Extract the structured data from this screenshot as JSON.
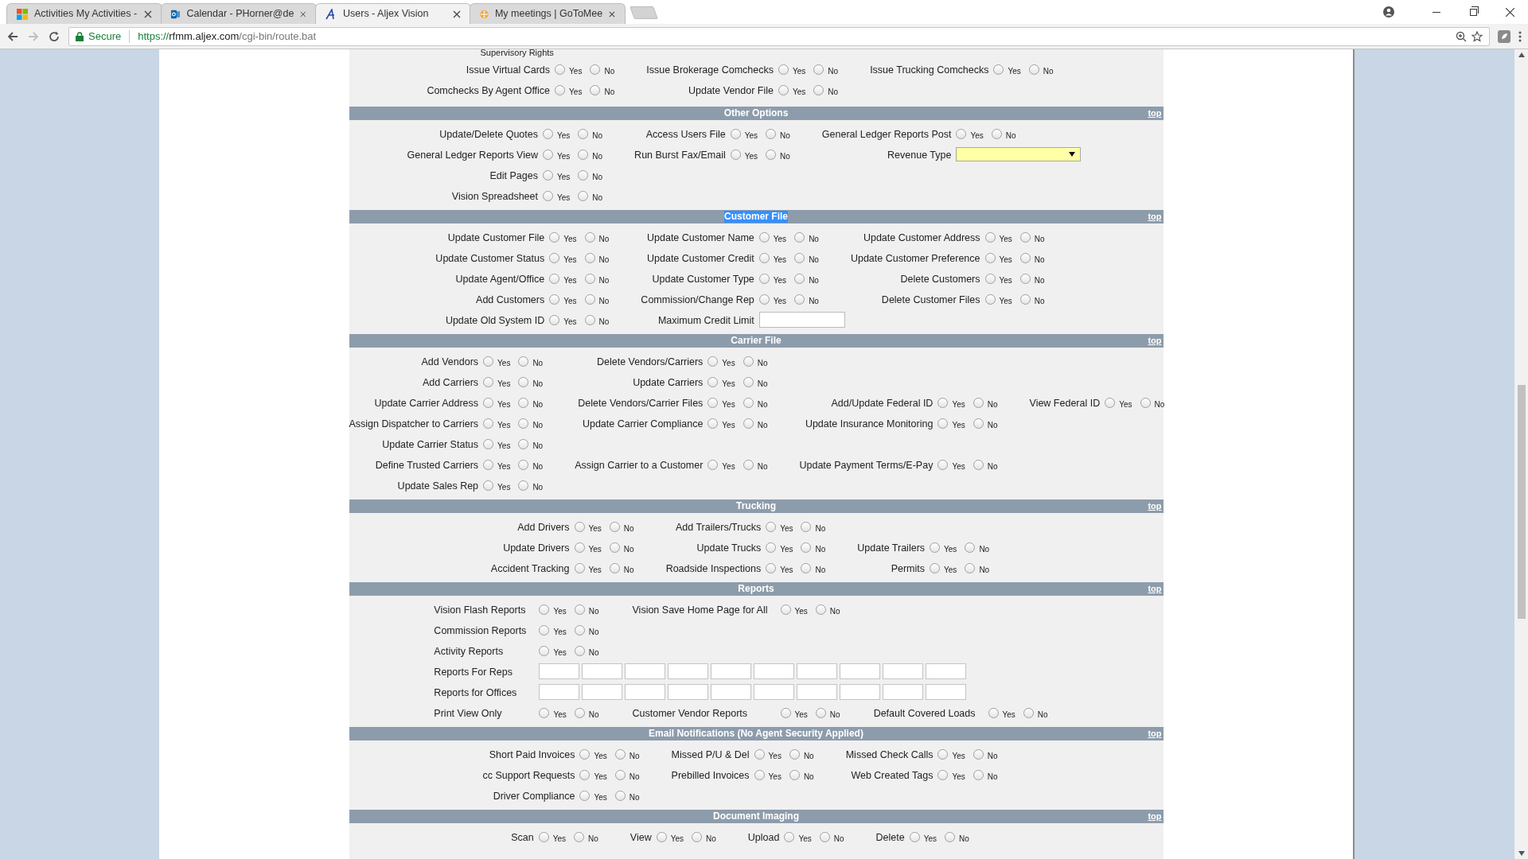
{
  "browser": {
    "tabs": [
      {
        "title": "Activities My Activities -",
        "selected": false
      },
      {
        "title": "Calendar - PHorner@de",
        "selected": false
      },
      {
        "title": "Users - Aljex Vision",
        "selected": true
      },
      {
        "title": "My meetings | GoToMee",
        "selected": false
      }
    ],
    "security": "Secure",
    "url_scheme": "https://",
    "url_host": "rfmm.aljex.com",
    "url_path": "/cgi-bin/route.bat"
  },
  "top_section": {
    "caption": "Supervisory Rights",
    "rows": [
      [
        {
          "kind": "yesno",
          "label": "Issue Virtual Cards",
          "options": [
            {
              "label": "Yes",
              "selected": false
            },
            {
              "label": "No",
              "selected": false
            }
          ]
        },
        {
          "kind": "yesno",
          "label": "Issue Brokerage Comchecks",
          "options": [
            {
              "label": "Yes",
              "selected": false
            },
            {
              "label": "No",
              "selected": false
            }
          ]
        },
        {
          "kind": "yesno",
          "label": "Issue Trucking Comchecks",
          "options": [
            {
              "label": "Yes",
              "selected": false
            },
            {
              "label": "No",
              "selected": false
            }
          ]
        }
      ],
      [
        {
          "kind": "yesno",
          "label": "Comchecks By Agent Office",
          "options": [
            {
              "label": "Yes",
              "selected": false
            },
            {
              "label": "No",
              "selected": false
            }
          ]
        },
        {
          "kind": "yesno",
          "label": "Update Vendor File",
          "options": [
            {
              "label": "Yes",
              "selected": false
            },
            {
              "label": "No",
              "selected": false
            }
          ]
        }
      ]
    ]
  },
  "sections": [
    {
      "title": "Other Options",
      "title_selected": false,
      "top_link": "top",
      "kind": "standard",
      "rows": [
        [
          {
            "kind": "yesno",
            "label": "Update/Delete Quotes",
            "options": [
              {
                "label": "Yes",
                "selected": false
              },
              {
                "label": "No",
                "selected": false
              }
            ]
          },
          {
            "kind": "yesno",
            "label": "Access Users File",
            "options": [
              {
                "label": "Yes",
                "selected": false
              },
              {
                "label": "No",
                "selected": false
              }
            ]
          },
          {
            "kind": "yesno",
            "label": "General Ledger Reports Post",
            "options": [
              {
                "label": "Yes",
                "selected": false
              },
              {
                "label": "No",
                "selected": false
              }
            ]
          }
        ],
        [
          {
            "kind": "yesno",
            "label": "General Ledger Reports View",
            "options": [
              {
                "label": "Yes",
                "selected": false
              },
              {
                "label": "No",
                "selected": false
              }
            ]
          },
          {
            "kind": "yesno",
            "label": "Run Burst Fax/Email",
            "options": [
              {
                "label": "Yes",
                "selected": false
              },
              {
                "label": "No",
                "selected": false
              }
            ]
          },
          {
            "kind": "select",
            "label": "Revenue Type"
          }
        ],
        [
          {
            "kind": "yesno",
            "label": "Edit Pages",
            "options": [
              {
                "label": "Yes",
                "selected": false
              },
              {
                "label": "No",
                "selected": false
              }
            ]
          }
        ],
        [
          {
            "kind": "yesno",
            "label": "Vision Spreadsheet",
            "options": [
              {
                "label": "Yes",
                "selected": false
              },
              {
                "label": "No",
                "selected": false
              }
            ]
          }
        ]
      ]
    },
    {
      "title": "Customer File",
      "title_selected": true,
      "top_link": "top",
      "kind": "standard",
      "rows": [
        [
          {
            "kind": "yesno",
            "label": "Update Customer File",
            "options": [
              {
                "label": "Yes",
                "selected": false
              },
              {
                "label": "No",
                "selected": false
              }
            ]
          },
          {
            "kind": "yesno",
            "label": "Update Customer Name",
            "options": [
              {
                "label": "Yes",
                "selected": false
              },
              {
                "label": "No",
                "selected": false
              }
            ]
          },
          {
            "kind": "yesno",
            "label": "Update Customer Address",
            "options": [
              {
                "label": "Yes",
                "selected": false
              },
              {
                "label": "No",
                "selected": false
              }
            ]
          }
        ],
        [
          {
            "kind": "yesno",
            "label": "Update Customer Status",
            "options": [
              {
                "label": "Yes",
                "selected": false
              },
              {
                "label": "No",
                "selected": false
              }
            ]
          },
          {
            "kind": "yesno",
            "label": "Update Customer Credit",
            "options": [
              {
                "label": "Yes",
                "selected": false
              },
              {
                "label": "No",
                "selected": false
              }
            ]
          },
          {
            "kind": "yesno",
            "label": "Update Customer Preference",
            "options": [
              {
                "label": "Yes",
                "selected": false
              },
              {
                "label": "No",
                "selected": false
              }
            ]
          }
        ],
        [
          {
            "kind": "yesno",
            "label": "Update Agent/Office",
            "options": [
              {
                "label": "Yes",
                "selected": false
              },
              {
                "label": "No",
                "selected": false
              }
            ]
          },
          {
            "kind": "yesno",
            "label": "Update Customer Type",
            "options": [
              {
                "label": "Yes",
                "selected": false
              },
              {
                "label": "No",
                "selected": false
              }
            ]
          },
          {
            "kind": "yesno",
            "label": "Delete Customers",
            "options": [
              {
                "label": "Yes",
                "selected": false
              },
              {
                "label": "No",
                "selected": false
              }
            ]
          }
        ],
        [
          {
            "kind": "yesno",
            "label": "Add Customers",
            "options": [
              {
                "label": "Yes",
                "selected": false
              },
              {
                "label": "No",
                "selected": false
              }
            ]
          },
          {
            "kind": "yesno",
            "label": "Commission/Change Rep",
            "options": [
              {
                "label": "Yes",
                "selected": false
              },
              {
                "label": "No",
                "selected": false
              }
            ]
          },
          {
            "kind": "yesno",
            "label": "Delete Customer Files",
            "options": [
              {
                "label": "Yes",
                "selected": false
              },
              {
                "label": "No",
                "selected": false
              }
            ]
          }
        ],
        [
          {
            "kind": "yesno",
            "label": "Update Old System ID",
            "options": [
              {
                "label": "Yes",
                "selected": false
              },
              {
                "label": "No",
                "selected": false
              }
            ]
          },
          {
            "kind": "text",
            "label": "Maximum Credit Limit"
          }
        ]
      ]
    },
    {
      "title": "Carrier File",
      "title_selected": false,
      "top_link": "top",
      "kind": "standard",
      "rows": [
        [
          {
            "kind": "yesno",
            "label": "Add Vendors",
            "options": [
              {
                "label": "Yes",
                "selected": false
              },
              {
                "label": "No",
                "selected": false
              }
            ]
          },
          {
            "kind": "yesno",
            "label": "Delete Vendors/Carriers",
            "options": [
              {
                "label": "Yes",
                "selected": false
              },
              {
                "label": "No",
                "selected": false
              }
            ]
          }
        ],
        [
          {
            "kind": "yesno",
            "label": "Add Carriers",
            "options": [
              {
                "label": "Yes",
                "selected": false
              },
              {
                "label": "No",
                "selected": false
              }
            ]
          },
          {
            "kind": "yesno",
            "label": "Update Carriers",
            "options": [
              {
                "label": "Yes",
                "selected": false
              },
              {
                "label": "No",
                "selected": false
              }
            ]
          }
        ],
        [
          {
            "kind": "yesno",
            "label": "Update Carrier Address",
            "options": [
              {
                "label": "Yes",
                "selected": false
              },
              {
                "label": "No",
                "selected": false
              }
            ]
          },
          {
            "kind": "yesno",
            "label": "Delete Vendors/Carrier Files",
            "options": [
              {
                "label": "Yes",
                "selected": false
              },
              {
                "label": "No",
                "selected": false
              }
            ]
          },
          {
            "kind": "yesno",
            "label": "Add/Update Federal ID",
            "options": [
              {
                "label": "Yes",
                "selected": false
              },
              {
                "label": "No",
                "selected": false
              }
            ]
          },
          {
            "kind": "yesno",
            "label": "View Federal ID",
            "options": [
              {
                "label": "Yes",
                "selected": false
              },
              {
                "label": "No",
                "selected": false
              }
            ]
          }
        ],
        [
          {
            "kind": "yesno",
            "label": "Assign Dispatcher to Carriers",
            "options": [
              {
                "label": "Yes",
                "selected": false
              },
              {
                "label": "No",
                "selected": false
              }
            ]
          },
          {
            "kind": "yesno",
            "label": "Update Carrier Compliance",
            "options": [
              {
                "label": "Yes",
                "selected": false
              },
              {
                "label": "No",
                "selected": false
              }
            ]
          },
          {
            "kind": "yesno",
            "label": "Update Insurance Monitoring",
            "options": [
              {
                "label": "Yes",
                "selected": false
              },
              {
                "label": "No",
                "selected": false
              }
            ]
          }
        ],
        [
          {
            "kind": "yesno",
            "label": "Update Carrier Status",
            "options": [
              {
                "label": "Yes",
                "selected": false
              },
              {
                "label": "No",
                "selected": false
              }
            ]
          }
        ],
        [
          {
            "kind": "yesno",
            "label": "Define Trusted Carriers",
            "options": [
              {
                "label": "Yes",
                "selected": false
              },
              {
                "label": "No",
                "selected": false
              }
            ]
          },
          {
            "kind": "yesno",
            "label": "Assign Carrier to a Customer",
            "options": [
              {
                "label": "Yes",
                "selected": false
              },
              {
                "label": "No",
                "selected": false
              }
            ]
          },
          {
            "kind": "yesno",
            "label": "Update Payment Terms/E-Pay",
            "options": [
              {
                "label": "Yes",
                "selected": false
              },
              {
                "label": "No",
                "selected": false
              }
            ]
          }
        ],
        [
          {
            "kind": "yesno",
            "label": "Update Sales Rep",
            "options": [
              {
                "label": "Yes",
                "selected": false
              },
              {
                "label": "No",
                "selected": false
              }
            ]
          }
        ]
      ]
    },
    {
      "title": "Trucking",
      "title_selected": false,
      "top_link": "top",
      "kind": "standard",
      "rows": [
        [
          {
            "kind": "yesno",
            "label": "Add Drivers",
            "options": [
              {
                "label": "Yes",
                "selected": false
              },
              {
                "label": "No",
                "selected": false
              }
            ]
          },
          {
            "kind": "yesno",
            "label": "Add Trailers/Trucks",
            "options": [
              {
                "label": "Yes",
                "selected": false
              },
              {
                "label": "No",
                "selected": false
              }
            ]
          }
        ],
        [
          {
            "kind": "yesno",
            "label": "Update Drivers",
            "options": [
              {
                "label": "Yes",
                "selected": false
              },
              {
                "label": "No",
                "selected": false
              }
            ]
          },
          {
            "kind": "yesno",
            "label": "Update Trucks",
            "options": [
              {
                "label": "Yes",
                "selected": false
              },
              {
                "label": "No",
                "selected": false
              }
            ]
          },
          {
            "kind": "yesno",
            "label": "Update Trailers",
            "options": [
              {
                "label": "Yes",
                "selected": false
              },
              {
                "label": "No",
                "selected": false
              }
            ]
          }
        ],
        [
          {
            "kind": "yesno",
            "label": "Accident Tracking",
            "options": [
              {
                "label": "Yes",
                "selected": false
              },
              {
                "label": "No",
                "selected": false
              }
            ]
          },
          {
            "kind": "yesno",
            "label": "Roadside Inspections",
            "options": [
              {
                "label": "Yes",
                "selected": false
              },
              {
                "label": "No",
                "selected": false
              }
            ]
          },
          {
            "kind": "yesno",
            "label": "Permits",
            "options": [
              {
                "label": "Yes",
                "selected": false
              },
              {
                "label": "No",
                "selected": false
              }
            ]
          }
        ]
      ]
    },
    {
      "title": "Reports",
      "title_selected": false,
      "top_link": "top",
      "kind": "report",
      "rows": [
        [
          {
            "kind": "yesno",
            "label": "Vision Flash Reports",
            "options": [
              {
                "label": "Yes",
                "selected": false
              },
              {
                "label": "No",
                "selected": false
              }
            ]
          },
          {
            "kind": "yesno",
            "label": "Vision Save Home Page for All",
            "options": [
              {
                "label": "Yes",
                "selected": false
              },
              {
                "label": "No",
                "selected": false
              }
            ]
          }
        ],
        [
          {
            "kind": "yesno",
            "label": "Commission Reports",
            "options": [
              {
                "label": "Yes",
                "selected": false
              },
              {
                "label": "No",
                "selected": false
              }
            ]
          }
        ],
        [
          {
            "kind": "yesno",
            "label": "Activity Reports",
            "options": [
              {
                "label": "Yes",
                "selected": false
              },
              {
                "label": "No",
                "selected": false
              }
            ]
          }
        ],
        [
          {
            "kind": "inputs",
            "label": "Reports For Reps"
          }
        ],
        [
          {
            "kind": "inputs",
            "label": "Reports for Offices"
          }
        ],
        [
          {
            "kind": "yesno",
            "label": "Print View Only",
            "options": [
              {
                "label": "Yes",
                "selected": false
              },
              {
                "label": "No",
                "selected": false
              }
            ]
          },
          {
            "kind": "yesno",
            "label": "Customer Vendor Reports",
            "options": [
              {
                "label": "Yes",
                "selected": false
              },
              {
                "label": "No",
                "selected": false
              }
            ]
          },
          {
            "kind": "yesno",
            "label": "Default Covered Loads",
            "options": [
              {
                "label": "Yes",
                "selected": false
              },
              {
                "label": "No",
                "selected": false
              }
            ]
          }
        ]
      ]
    },
    {
      "title": "Email Notifications (No Agent Security Applied)",
      "title_selected": false,
      "top_link": "top",
      "kind": "standard",
      "rows": [
        [
          {
            "kind": "yesno",
            "label": "Short Paid Invoices",
            "options": [
              {
                "label": "Yes",
                "selected": false
              },
              {
                "label": "No",
                "selected": false
              }
            ]
          },
          {
            "kind": "yesno",
            "label": "Missed P/U & Del",
            "options": [
              {
                "label": "Yes",
                "selected": false
              },
              {
                "label": "No",
                "selected": false
              }
            ]
          },
          {
            "kind": "yesno",
            "label": "Missed Check Calls",
            "options": [
              {
                "label": "Yes",
                "selected": false
              },
              {
                "label": "No",
                "selected": false
              }
            ]
          }
        ],
        [
          {
            "kind": "yesno",
            "label": "cc Support Requests",
            "options": [
              {
                "label": "Yes",
                "selected": false
              },
              {
                "label": "No",
                "selected": false
              }
            ]
          },
          {
            "kind": "yesno",
            "label": "Prebilled Invoices",
            "options": [
              {
                "label": "Yes",
                "selected": false
              },
              {
                "label": "No",
                "selected": false
              }
            ]
          },
          {
            "kind": "yesno",
            "label": "Web Created Tags",
            "options": [
              {
                "label": "Yes",
                "selected": false
              },
              {
                "label": "No",
                "selected": false
              }
            ]
          }
        ],
        [
          {
            "kind": "yesno",
            "label": "Driver Compliance",
            "options": [
              {
                "label": "Yes",
                "selected": false
              },
              {
                "label": "No",
                "selected": false
              }
            ]
          }
        ]
      ]
    },
    {
      "title": "Document Imaging",
      "title_selected": false,
      "top_link": "top",
      "kind": "standard",
      "rows": [
        [
          {
            "kind": "yesno",
            "label": "Scan",
            "options": [
              {
                "label": "Yes",
                "selected": false
              },
              {
                "label": "No",
                "selected": false
              }
            ]
          },
          {
            "kind": "yesno",
            "label": "View",
            "options": [
              {
                "label": "Yes",
                "selected": false
              },
              {
                "label": "No",
                "selected": false
              }
            ]
          },
          {
            "kind": "yesno",
            "label": "Upload",
            "options": [
              {
                "label": "Yes",
                "selected": false
              },
              {
                "label": "No",
                "selected": false
              }
            ]
          },
          {
            "kind": "yesno",
            "label": "Delete",
            "options": [
              {
                "label": "Yes",
                "selected": false
              },
              {
                "label": "No",
                "selected": false
              }
            ]
          }
        ]
      ]
    }
  ]
}
